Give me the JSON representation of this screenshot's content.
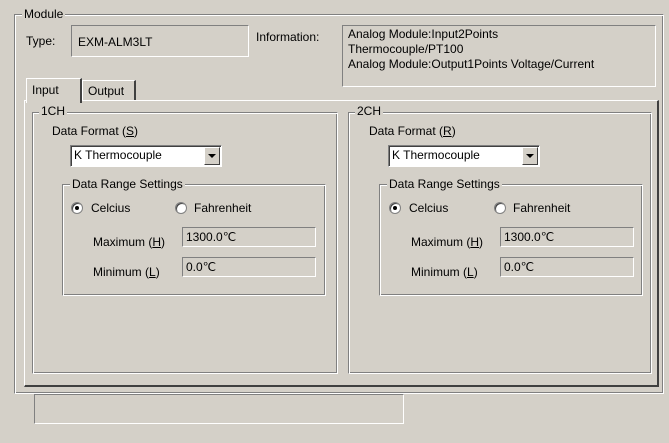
{
  "module": {
    "group_label": "Module",
    "type_label": "Type:",
    "type_value": "EXM-ALM3LT",
    "info_label": "Information:",
    "info_lines": [
      "Analog Module:Input2Points",
      "Thermocouple/PT100",
      "Analog Module:Output1Points Voltage/Current"
    ]
  },
  "tabs": [
    {
      "label": "Input",
      "active": true
    },
    {
      "label": "Output",
      "active": false
    }
  ],
  "ch1": {
    "group_label": "1CH",
    "data_format_label": "Data Format (",
    "data_format_key": "S",
    "data_format_suffix": ")",
    "data_format_value": "K Thermocouple",
    "range_group_label": "Data Range Settings",
    "celsius_label": "Celcius",
    "fahrenheit_label": "Fahrenheit",
    "celsius_selected": true,
    "maximum_label": "Maximum (",
    "maximum_key": "H",
    "maximum_suffix": ")",
    "maximum_value": "1300.0℃",
    "minimum_label": "Minimum (",
    "minimum_key": "L",
    "minimum_suffix": ")",
    "minimum_value": "0.0℃"
  },
  "ch2": {
    "group_label": "2CH",
    "data_format_label": "Data Format (",
    "data_format_key": "R",
    "data_format_suffix": ")",
    "data_format_value": "K Thermocouple",
    "range_group_label": "Data Range Settings",
    "celsius_label": "Celcius",
    "fahrenheit_label": "Fahrenheit",
    "celsius_selected": true,
    "maximum_label": "Maximum (",
    "maximum_key": "H",
    "maximum_suffix": ")",
    "maximum_value": "1300.0℃",
    "minimum_label": "Minimum (",
    "minimum_key": "L",
    "minimum_suffix": ")",
    "minimum_value": "0.0℃"
  },
  "status_bar": {
    "text": ""
  }
}
